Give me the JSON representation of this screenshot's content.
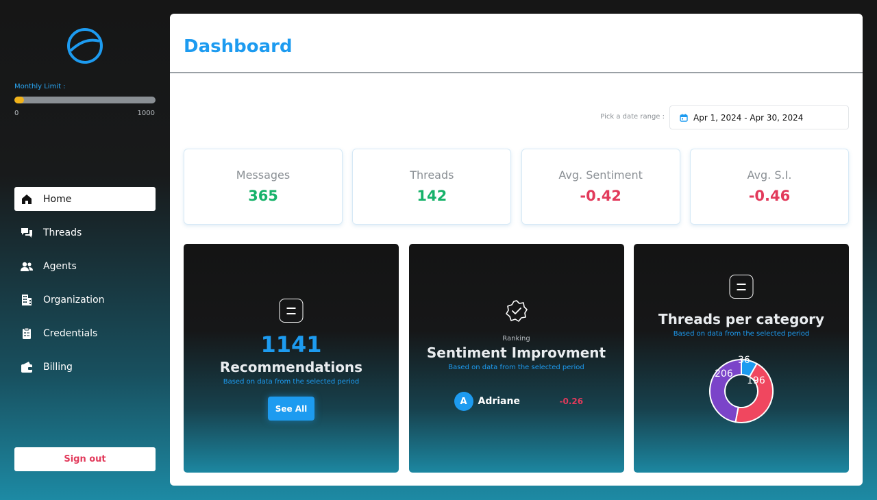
{
  "sidebar": {
    "monthly_limit_label": "Monthly Limit :",
    "limit_min": "0",
    "limit_max": "1000",
    "limit_usage_fraction": 0.07,
    "items": [
      {
        "label": "Home",
        "icon": "home-icon",
        "active": true
      },
      {
        "label": "Threads",
        "icon": "chat-icon",
        "active": false
      },
      {
        "label": "Agents",
        "icon": "users-icon",
        "active": false
      },
      {
        "label": "Organization",
        "icon": "building-icon",
        "active": false
      },
      {
        "label": "Credentials",
        "icon": "clipboard-icon",
        "active": false
      },
      {
        "label": "Billing",
        "icon": "wallet-icon",
        "active": false
      }
    ],
    "sign_out_label": "Sign out"
  },
  "header": {
    "title": "Dashboard"
  },
  "date_range": {
    "label": "Pick a date range :",
    "value": "Apr 1, 2024 - Apr 30, 2024"
  },
  "stats": [
    {
      "label": "Messages",
      "value": "365"
    },
    {
      "label": "Threads",
      "value": "142"
    },
    {
      "label": "Avg. Sentiment",
      "value": "-0.42"
    },
    {
      "label": "Avg. S.I.",
      "value": "-0.46"
    }
  ],
  "tiles": {
    "recommendations": {
      "count": "1141",
      "title": "Recommendations",
      "subtitle": "Based on data from the selected period",
      "button_label": "See All"
    },
    "sentiment": {
      "ranking_label": "Ranking",
      "title": "Sentiment Improvment",
      "subtitle": "Based on data from the selected period",
      "agent_initial": "A",
      "agent_name": "Adriane",
      "agent_value": "-0.26"
    },
    "threads_category": {
      "title": "Threads per category",
      "subtitle": "Based on data from the selected period",
      "segments": [
        {
          "label": "36",
          "value": 36,
          "color": "#1d9bf0"
        },
        {
          "label": "196",
          "value": 196,
          "color": "#f0475f"
        },
        {
          "label": "206",
          "value": 206,
          "color": "#7b44c9"
        }
      ]
    }
  },
  "colors": {
    "accent": "#1d9bf0",
    "positive": "#17b26a",
    "negative": "#e23a5b",
    "limit_fill": "#f0b21a"
  }
}
